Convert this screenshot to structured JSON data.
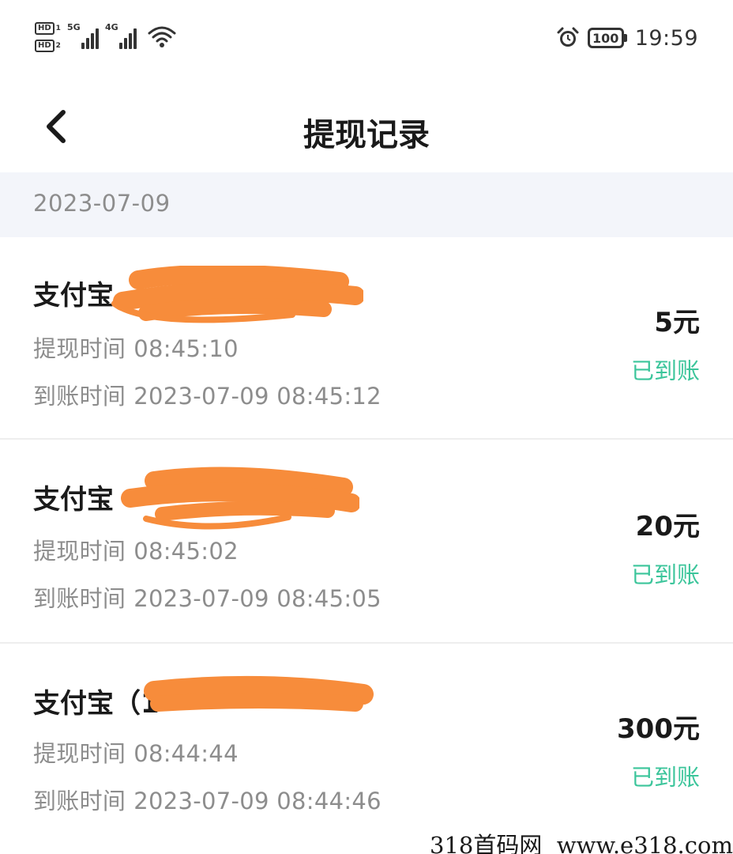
{
  "status_bar": {
    "hd1": "HD",
    "hd1_sub": "1",
    "hd2": "HD",
    "hd2_sub": "2",
    "sim1_network": "5G",
    "sim2_network": "4G",
    "battery": "100",
    "time": "19:59"
  },
  "header": {
    "title": "提现记录"
  },
  "date_group": "2023-07-09",
  "records": [
    {
      "title": "支付宝",
      "withdraw_label": "提现时间",
      "withdraw_time": "08:45:10",
      "arrive_label": "到账时间",
      "arrive_time": "2023-07-09 08:45:12",
      "amount": "5元",
      "status": "已到账"
    },
    {
      "title": "支付宝",
      "withdraw_label": "提现时间",
      "withdraw_time": "08:45:02",
      "arrive_label": "到账时间",
      "arrive_time": "2023-07-09 08:45:05",
      "amount": "20元",
      "status": "已到账"
    },
    {
      "title": "支付宝（1",
      "withdraw_label": "提现时间",
      "withdraw_time": "08:44:44",
      "arrive_label": "到账时间",
      "arrive_time": "2023-07-09 08:44:46",
      "amount": "300元",
      "status": "已到账"
    }
  ],
  "watermark": "318首码网  www.e318.com",
  "colors": {
    "status_green": "#3cc59b",
    "redaction_orange": "#f78c3b",
    "date_bar_bg": "#f3f5fa",
    "secondary_text": "#8d8d8d"
  }
}
